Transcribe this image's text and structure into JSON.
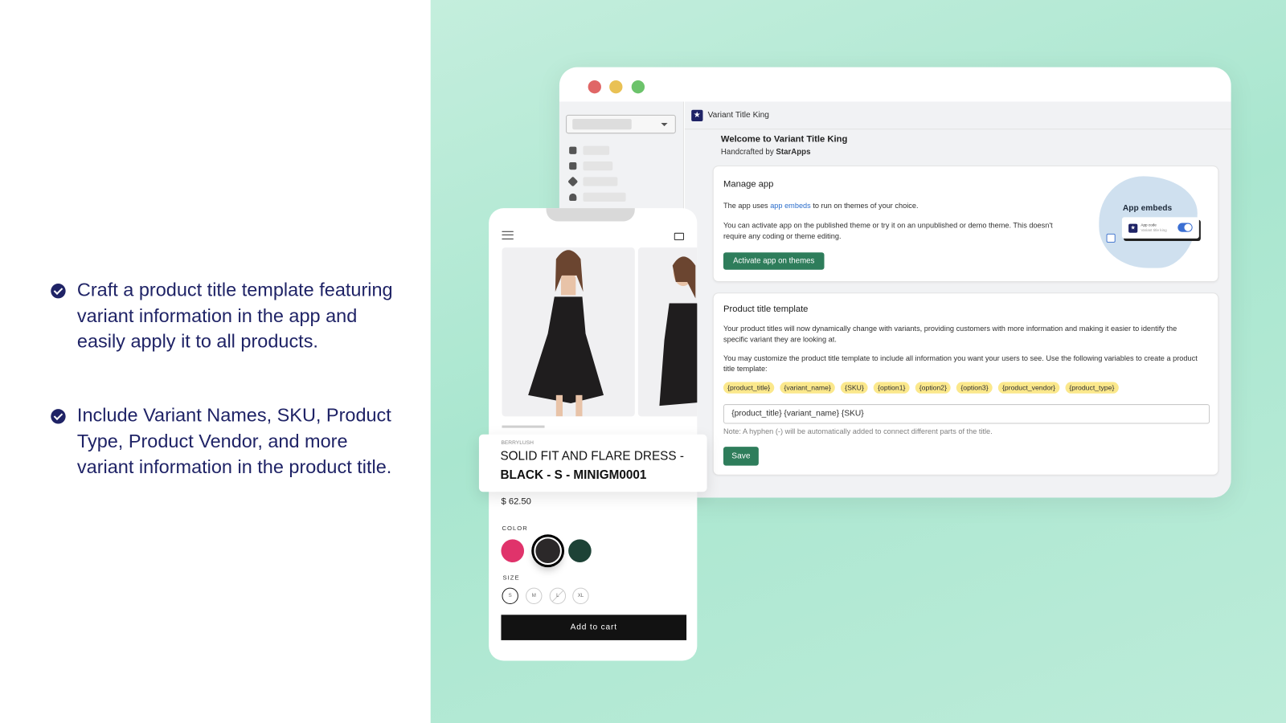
{
  "bullets": [
    "Craft a product title template featuring variant information in the app and easily apply it to all products.",
    "Include Variant Names, SKU, Product Type, Product Vendor, and more variant information in the product title."
  ],
  "colors": {
    "accent": "#1f2366",
    "primary_button": "#2e7d5b",
    "chip": "#fbe88c",
    "link": "#2c6ecb"
  },
  "window": {
    "controls": [
      "close",
      "minimize",
      "maximize"
    ]
  },
  "app": {
    "name": "Variant Title King",
    "welcome": "Welcome to Variant Title King",
    "handcrafted_prefix": "Handcrafted by ",
    "handcrafted_brand": "StarApps",
    "manage": {
      "title": "Manage app",
      "line1_pre": "The app uses ",
      "line1_link": "app embeds",
      "line1_post": " to run on themes of your choice.",
      "line2": "You can activate app on the published theme or try it on an unpublished or demo theme. This doesn't require any coding or theme editing.",
      "button": "Activate app on themes",
      "illustration": {
        "title": "App embeds",
        "item": "App code",
        "item_sub": "Variant title king",
        "toggle_on": true
      }
    },
    "template": {
      "title": "Product title template",
      "p1": "Your product titles will now dynamically change with variants, providing customers with more information and making it easier to identify the specific variant they are looking at.",
      "p2": "You may customize the product title template to include all information you want your users to see. Use the following variables to create a product title template:",
      "variables": [
        "{product_title}",
        "{variant_name}",
        "{SKU}",
        "{option1}",
        "{option2}",
        "{option3}",
        "{product_vendor}",
        "{product_type}"
      ],
      "value": "{product_title} {variant_name} {SKU}",
      "note": "Note: A hyphen (-) will be automatically added to connect different parts of the title.",
      "save": "Save"
    }
  },
  "sidebar_icons": [
    "home-icon",
    "inbox-icon",
    "tag-icon",
    "person-icon"
  ],
  "product": {
    "vendor": "BERRYLUSH",
    "title_line1": "SOLID FIT AND FLARE DRESS -",
    "title_line2": "BLACK - S - MINIGM0001",
    "price": "$ 62.50",
    "color_label": "COLOR",
    "colors": [
      "#e0336b",
      "#2b2829",
      "#1d4236"
    ],
    "selected_color": 1,
    "size_label": "SIZE",
    "sizes": [
      "S",
      "M",
      "L",
      "XL"
    ],
    "selected_size": "S",
    "unavailable_size": "L",
    "add_to_cart": "Add to cart"
  }
}
